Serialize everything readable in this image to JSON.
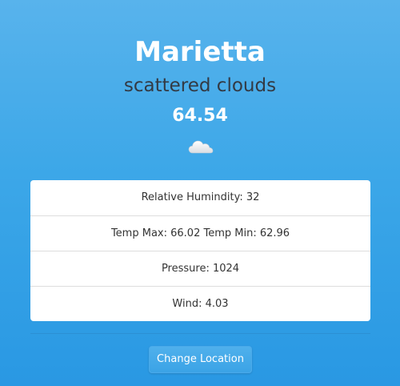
{
  "weather": {
    "city": "Marietta",
    "description": "scattered clouds",
    "temperature": "64.54",
    "icon": "cloud-icon"
  },
  "details": [
    {
      "text": "Relative Humindity: 32"
    },
    {
      "text": "Temp Max: 66.02 Temp Min: 62.96"
    },
    {
      "text": "Pressure: 1024"
    },
    {
      "text": "Wind: 4.03"
    }
  ],
  "actions": {
    "change_location_label": "Change Location"
  },
  "colors": {
    "background_top": "#58b3ec",
    "background_bottom": "#2998e3",
    "description_text": "#333a44",
    "card_background": "#ffffff",
    "button_background": "#3ba3e6"
  }
}
